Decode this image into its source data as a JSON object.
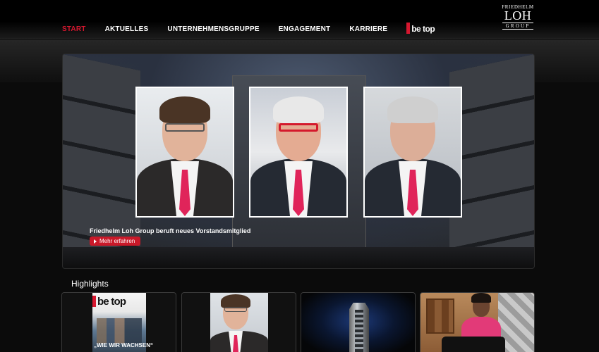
{
  "nav": {
    "items": [
      {
        "label": "START",
        "active": true
      },
      {
        "label": "AKTUELLES",
        "active": false
      },
      {
        "label": "UNTERNEHMENSGRUPPE",
        "active": false
      },
      {
        "label": "ENGAGEMENT",
        "active": false
      },
      {
        "label": "KARRIERE",
        "active": false
      }
    ],
    "betop_label": "be top"
  },
  "logo": {
    "top": "FRIEDHELM",
    "middle": "LOH",
    "bottom": "GROUP"
  },
  "hero": {
    "caption": "Friedhelm Loh Group beruft neues Vorstandsmitglied",
    "button_label": "Mehr erfahren"
  },
  "highlights": {
    "title": "Highlights",
    "magazine": {
      "brand": "be top",
      "headline": "„WIE WIR WACHSEN“"
    }
  },
  "colors": {
    "accent": "#d6172f",
    "background": "#0b0b0b",
    "tie": "#e0245a"
  },
  "icons": {
    "button_arrow": "play-arrow-icon"
  }
}
